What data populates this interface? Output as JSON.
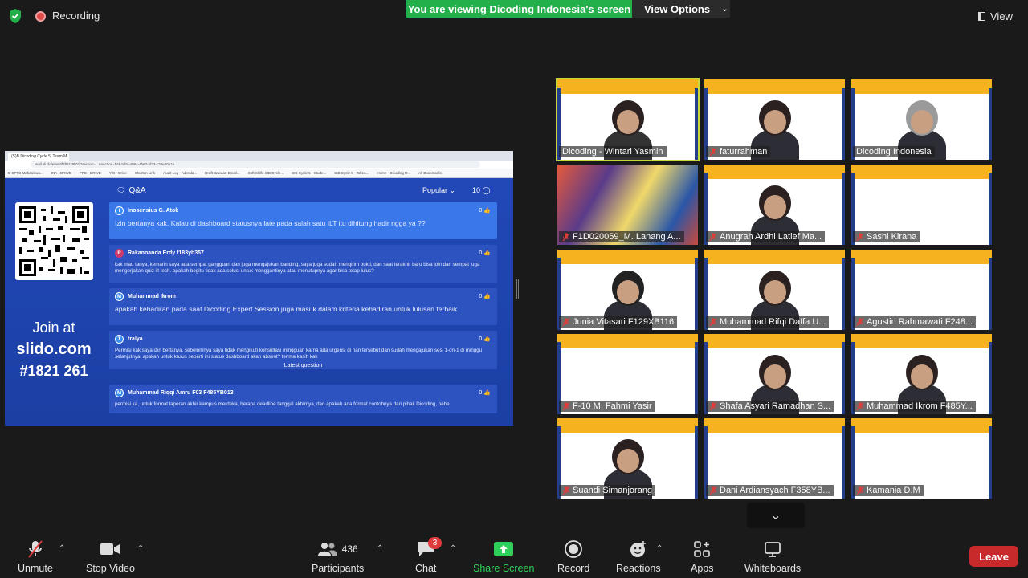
{
  "top": {
    "recording_label": "Recording",
    "viewing_banner": "You are viewing Dicoding Indonesia's screen",
    "view_options_label": "View Options",
    "view_label": "View"
  },
  "share": {
    "browser_tab": "(S)B Dicoding Cycle 5| Team Mi...",
    "url": "wall.sli.do/event/f4fUzx9f7d/?section=...&section=b6b4cf6f-4884-4b63-bf33-c38e40b1e",
    "bookmarks": [
      "E-SPTS Mahasiswa...",
      "INA - DRIVE",
      "PRE - DRIVE",
      "YCI - Drive",
      "Shorten Link",
      "Audit Log - Adenda...",
      "Draft Bawaan Email...",
      "Soft Skills SIB Cycle...",
      "SIB Cycle 5 - Stude...",
      "SIB Cycle 5 - Token...",
      "Home - Dicoding D...",
      "All Bookmarks"
    ],
    "join_at": "Join at",
    "slido_url": "slido.com",
    "slido_code": "#1821 261",
    "qa_title": "Q&A",
    "sort_label": "Popular",
    "question_count": "10",
    "latest_label": "Latest question",
    "questions": [
      {
        "initial": "I",
        "author": "Inosensius G. Atok",
        "likes": "0",
        "text": "Izin bertanya kak. Kalau di dashboard statusnya late pada salah satu ILT itu dihitung hadir ngga ya ??"
      },
      {
        "initial": "R",
        "author": "Rakannanda Erdy f183yb357",
        "likes": "0",
        "text": "kak mau tanya, kemarin saya ada sempat gangguan dan juga mengajukan banding, saya juga sudah mengirim bukti, dan saat terakhir baru bisa join dan sempat juga mengerjakan quiz ilt tech. apakah begitu tidak ada solusi untuk menggantinya atau menutupnya agar bisa tetap lulus?"
      },
      {
        "initial": "M",
        "author": "Muhammad Ikrom",
        "likes": "0",
        "text": "apakah kehadiran pada saat Dicoding Expert Session juga masuk dalam kriteria kehadiran untuk lulusan terbaik"
      },
      {
        "initial": "T",
        "author": "tralya",
        "likes": "0",
        "text": "Permisi kak saya izin bertanya, sebelumnya saya tidak mengikuti konsultasi mingguan karna ada urgensi di hari tersebut dan sudah mengajukan sesi 1-on-1 di minggu selanjutnya. apakah untuk kasus seperti ini status dashboard akan absent? terima kasih kak"
      },
      {
        "initial": "M",
        "author": "Muhammad Riqqi Amru F03 F485YB013",
        "likes": "0",
        "text": "permisi ka, untuk format laporan akhir kampus merdeka, berapa deadline tanggal akhirnya, dan apakah ada format contohnya dari pihak Dicoding, hehe"
      }
    ]
  },
  "participants_grid": [
    {
      "name": "Dicoding - Wintari Yasmin",
      "muted": false,
      "speaking": true
    },
    {
      "name": "faturrahman",
      "muted": true
    },
    {
      "name": "Dicoding Indonesia",
      "muted": false
    },
    {
      "name": "F1D020059_M. Lanang A...",
      "muted": true
    },
    {
      "name": "Anugrah Ardhi Latief Ma...",
      "muted": true
    },
    {
      "name": "Sashi Kirana",
      "muted": true
    },
    {
      "name": "Junia Vitasari F129XB116",
      "muted": true
    },
    {
      "name": "Muhammad Rifqi Daffa U...",
      "muted": true
    },
    {
      "name": "Agustin Rahmawati F248...",
      "muted": true
    },
    {
      "name": "F-10 M. Fahmi Yasir",
      "muted": true
    },
    {
      "name": "Shafa Asyari Ramadhan S...",
      "muted": true
    },
    {
      "name": "Muhammad Ikrom F485Y...",
      "muted": true
    },
    {
      "name": "Suandi Simanjorang",
      "muted": true
    },
    {
      "name": "Dani Ardiansyach F358YB...",
      "muted": true
    },
    {
      "name": "Kamania D.M",
      "muted": true
    }
  ],
  "toolbar": {
    "unmute": "Unmute",
    "stop_video": "Stop Video",
    "participants": "Participants",
    "participants_count": "436",
    "chat": "Chat",
    "chat_badge": "3",
    "share_screen": "Share Screen",
    "record": "Record",
    "reactions": "Reactions",
    "apps": "Apps",
    "whiteboards": "Whiteboards",
    "leave": "Leave"
  },
  "colors": {
    "share_green": "#2fd05a",
    "banner_green": "#23b04b",
    "leave_red": "#c8292a",
    "slido_blue": "#2248b8",
    "tile_yellow": "#f6b31f"
  }
}
